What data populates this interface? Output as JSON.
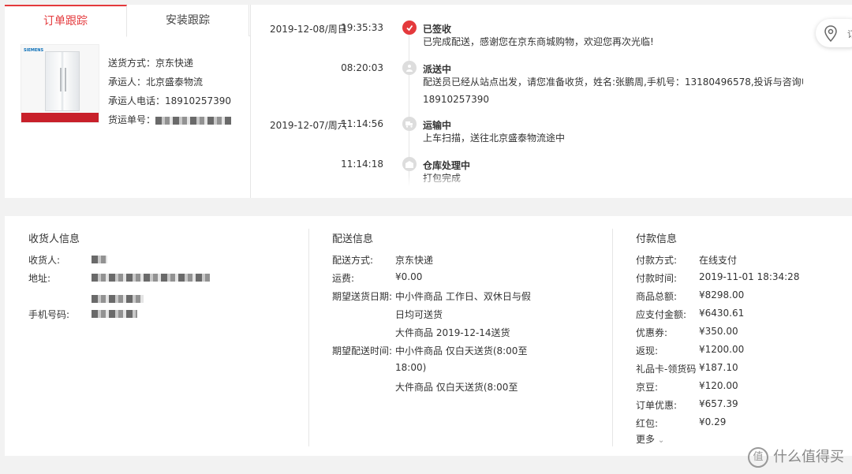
{
  "tabs": [
    {
      "label": "订单跟踪",
      "active": true
    },
    {
      "label": "安装跟踪",
      "active": false
    }
  ],
  "product": {
    "brand_text": "SIEMENS",
    "shipping_method": "送货方式：京东快递",
    "carrier": "承运人：北京盛泰物流",
    "carrier_phone_label": "承运人电话：",
    "carrier_phone": "18910257390",
    "tracking_label": "货运单号："
  },
  "timeline": [
    {
      "date": "2019-12-08/周日",
      "time": "19:35:33",
      "title": "已签收",
      "desc": [
        "已完成配送，感谢您在京东商城购物，欢迎您再次光临!"
      ],
      "active": true,
      "icon": "check-icon"
    },
    {
      "date": "",
      "time": "08:20:03",
      "title": "派送中",
      "desc": [
        "配送员已经从站点出发，请您准备收货，姓名:张鹏周,手机号：13180496578,投诉与咨询电话：",
        "18910257390"
      ],
      "active": false,
      "icon": "courier-icon"
    },
    {
      "date": "2019-12-07/周六",
      "time": "11:14:56",
      "title": "运输中",
      "desc": [
        "上车扫描，送往北京盛泰物流途中"
      ],
      "active": false,
      "icon": "truck-icon"
    },
    {
      "date": "",
      "time": "11:14:18",
      "title": "仓库处理中",
      "desc": [
        "打包完成"
      ],
      "active": false,
      "icon": "warehouse-icon"
    }
  ],
  "map_button": {
    "label": "订",
    "icon": "map-pin-icon"
  },
  "receiver": {
    "title": "收货人信息",
    "rows": [
      {
        "label": "收货人:"
      },
      {
        "label": "地址:"
      },
      {
        "label": "手机号码:"
      }
    ]
  },
  "delivery": {
    "title": "配送信息",
    "rows": [
      {
        "label": "配送方式:",
        "value": "京东快递"
      },
      {
        "label": "运费:",
        "value": "¥0.00"
      },
      {
        "label": "期望送货日期:",
        "value": "中小件商品 工作日、双休日与假"
      },
      {
        "label": "",
        "value": "日均可送货"
      },
      {
        "label": "",
        "value": "大件商品 2019-12-14送货"
      },
      {
        "label": "期望配送时间:",
        "value": "中小件商品 仅白天送货(8:00至"
      },
      {
        "label": "",
        "value": "18:00)"
      },
      {
        "label": "",
        "value": "大件商品 仅白天送货(8:00至"
      }
    ]
  },
  "payment": {
    "title": "付款信息",
    "rows": [
      {
        "label": "付款方式:",
        "value": "在线支付"
      },
      {
        "label": "付款时间:",
        "value": "2019-11-01 18:34:28"
      },
      {
        "label": "商品总额:",
        "value": "¥8298.00"
      },
      {
        "label": "应支付金额:",
        "value": "¥6430.61"
      },
      {
        "label": "优惠券:",
        "value": "¥350.00"
      },
      {
        "label": "返现:",
        "value": "¥1200.00"
      },
      {
        "label": "礼品卡-领货码",
        "value": "¥187.10"
      },
      {
        "label": "京豆:",
        "value": "¥120.00"
      },
      {
        "label": "订单优惠:",
        "value": "¥657.39"
      },
      {
        "label": "红包:",
        "value": "¥0.29"
      }
    ],
    "more_label": "更多"
  },
  "watermark": "什么值得买",
  "colors": {
    "accent": "#e4393c",
    "page_bg": "#f2f2f2",
    "divider": "#e6e6e6"
  }
}
